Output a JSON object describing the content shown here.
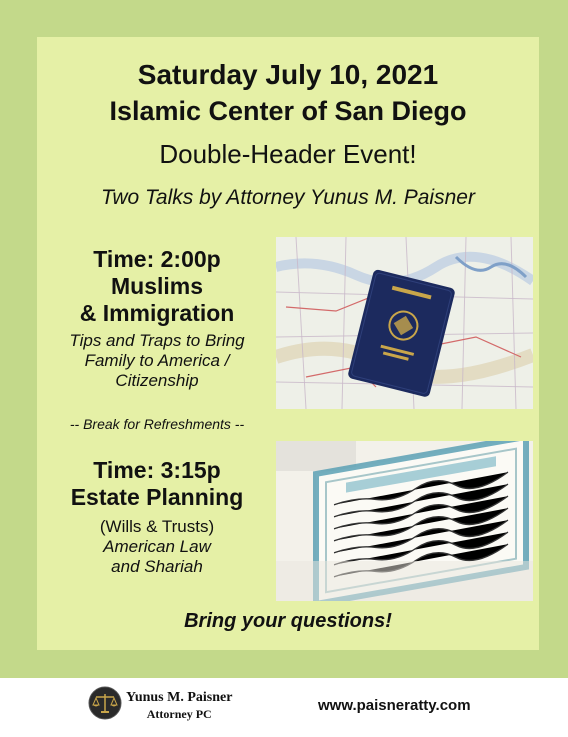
{
  "flyer": {
    "date_line": "Saturday July 10, 2021",
    "venue": "Islamic Center of San Diego",
    "event_type": "Double-Header Event!",
    "subtitle": "Two Talks by Attorney Yunus M. Paisner",
    "talk1": {
      "time": "Time: 2:00p",
      "title_line1": "Muslims",
      "title_line2": "& Immigration",
      "desc_line1": "Tips and Traps to Bring",
      "desc_line2": "Family to America /",
      "desc_line3": "Citizenship",
      "image_icon": "passport-on-map-photo"
    },
    "break_text": "-- Break for Refreshments --",
    "talk2": {
      "time": "Time: 3:15p",
      "title": "Estate Planning",
      "sub": "(Wills & Trusts)",
      "desc_line1": "American Law",
      "desc_line2": "and Shariah",
      "image_icon": "quran-page-photo"
    },
    "closing": "Bring your questions!"
  },
  "footer": {
    "firm_name": "Yunus M. Paisner",
    "firm_sub": "Attorney PC",
    "website": "www.paisneratty.com",
    "logo_icon": "scales-of-justice-icon"
  },
  "colors": {
    "outer_green": "#c3d98a",
    "inner_green": "#e5f0a6",
    "passport_blue": "#1c2a5e",
    "gold": "#c9a64a"
  }
}
